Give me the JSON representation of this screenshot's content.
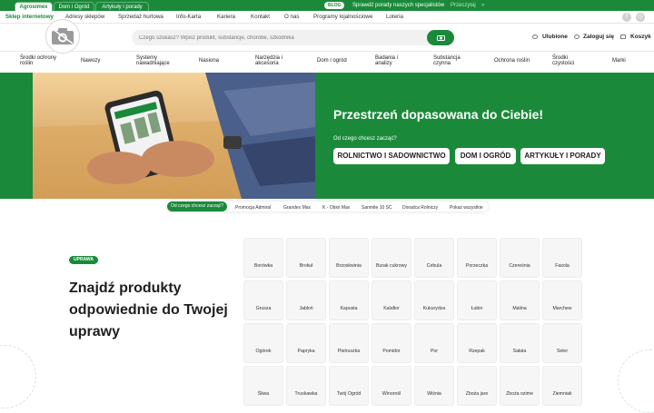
{
  "top_tabs": [
    "Agrosimex",
    "Dom i Ogród",
    "Artykuły i porady"
  ],
  "blog": {
    "badge": "BLOG",
    "text": "Sprawdź porady naszych specjalistów",
    "link": "Przeczytaj",
    "arrow": "»"
  },
  "nav": [
    "Sklep internetowy",
    "Adresy sklepów",
    "Sprzedaż hurtowa",
    "Info-Karta",
    "Kariera",
    "Kontakt",
    "O nas",
    "Programy lojalnościowe",
    "Loteria"
  ],
  "social_icons": [
    "facebook-icon",
    "instagram-icon"
  ],
  "search": {
    "placeholder": "Czego szukasz? Wpisz produkt, substancje, chorobe, szkodnika"
  },
  "header_links": [
    "Ulubione",
    "Zaloguj się",
    "Koszyk"
  ],
  "categories": [
    "Środki ochrony roślin",
    "Nawozy",
    "Systemy nawadniające",
    "Nasiona",
    "Narzędzia i akcesoria",
    "Dom i ogród",
    "Badania i analizy",
    "Substancja czynna",
    "Ochrona roślin",
    "Środki czystości",
    "Marki"
  ],
  "hero": {
    "title": "Przestrzeń dopasowana do Ciebie!",
    "subtitle": "Od czego chcesz zacząć?",
    "buttons": [
      "ROLNICTWO I SADOWNICTWO",
      "DOM I OGRÓD",
      "ARTYKUŁY I PORADY"
    ]
  },
  "chips": [
    "Od czego chcesz zacząć?",
    "Promocja Admiral",
    "Grandex Max",
    "K - Obiol Max",
    "Sanmite 10 SC",
    "Doradca Rolniczy",
    "Pokaż wszystkie"
  ],
  "crops_section": {
    "badge": "UPRAWA",
    "title": "Znajdź produkty odpowiednie do Twojej uprawy",
    "crops": [
      "Borówka",
      "Brokuł",
      "Brzoskwinia",
      "Burak cukrowy",
      "Cebula",
      "Porzeczka",
      "Czereśnia",
      "Fasola",
      "Grusza",
      "Jabłoń",
      "Kapusta",
      "Kalafior",
      "Kukurydza",
      "Łubin",
      "Malina",
      "Marchew",
      "Ogórek",
      "Papryka",
      "Pietruszka",
      "Pomidor",
      "Por",
      "Rzepak",
      "Sałata",
      "Seler",
      "Śliwa",
      "Truskawka",
      "Twój Ogród",
      "Winorośl",
      "Wiśnia",
      "Zboża jare",
      "Zboża ozime",
      "Ziemniak"
    ]
  },
  "colors": {
    "brand_green": "#1a8a3a",
    "text": "#1f1f1f"
  }
}
